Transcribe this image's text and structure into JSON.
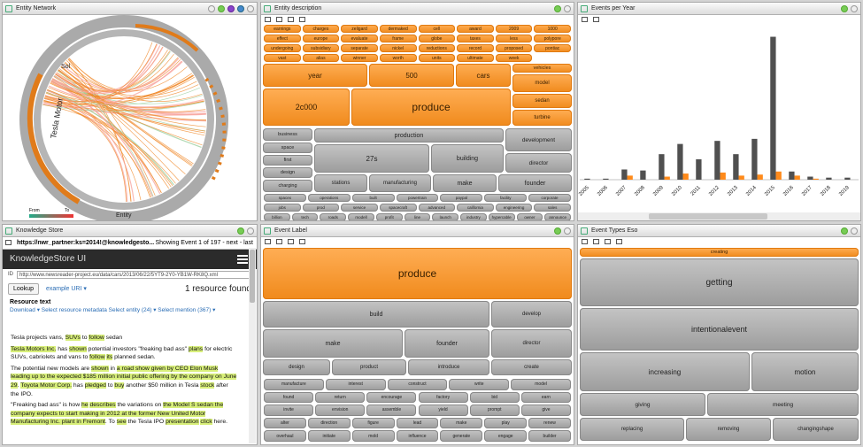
{
  "panels": {
    "network": "Entity Network",
    "entity": "Entity description",
    "events": "Events per Year",
    "ks": "Knowledge Store",
    "label": "Event Label",
    "types": "Event Types Eso"
  },
  "network": {
    "legend_from": "From",
    "legend_to": "To",
    "labels": [
      "Tesla Motor",
      "Entity",
      "Sol"
    ]
  },
  "entity_small": [
    [
      "earnings",
      "charges",
      "zeligard",
      "dermaked",
      "cell",
      "award",
      "2009",
      "1000"
    ],
    [
      "effect",
      "europe",
      "evaluate",
      "frame",
      "globe",
      "taxes",
      "less",
      "polypore"
    ],
    [
      "undergoing",
      "subsidiary",
      "separate",
      "nickel",
      "reductions",
      "record",
      "proposed",
      "pontiac"
    ],
    [
      "vast",
      "alias",
      "winner",
      "worth",
      "units",
      "ultimate",
      "week",
      ""
    ]
  ],
  "entity_big": {
    "year": "year",
    "v500": "500",
    "cars": "cars",
    "vehicles": "vehicles",
    "model": "model",
    "sedan": "sedan",
    "turbine": "turbine",
    "c2000": "2c000",
    "produce": "produce"
  },
  "entity_gray": {
    "business": "business",
    "space": "space",
    "first": "first",
    "design": "design",
    "charging": "charging",
    "production": "production",
    "development": "development",
    "t27s": "27s",
    "building": "building",
    "director": "director",
    "stations": "stations",
    "manufacturing": "manufacturing",
    "make": "make",
    "founder": "founder"
  },
  "entity_gray_small": [
    [
      "spacex",
      "operations",
      "built",
      "powertrain",
      "paypal",
      "facility",
      "corporate"
    ],
    [
      "jobs",
      "prod",
      "service",
      "spacecraft",
      "advanced",
      "california",
      "engineering",
      "sales"
    ],
    [
      "billion",
      "tech",
      "roads",
      "modell",
      "profit",
      "line",
      "launch",
      "industry",
      "hypercable",
      "owner",
      "announce"
    ]
  ],
  "chart_data": {
    "type": "bar",
    "categories": [
      "2005",
      "2006",
      "2007",
      "2008",
      "2009",
      "2010",
      "2011",
      "2012",
      "2013",
      "2014",
      "2015",
      "2016",
      "2017",
      "2018",
      "2019"
    ],
    "series": [
      {
        "values": [
          1,
          1,
          10,
          9,
          25,
          35,
          20,
          38,
          25,
          40,
          140,
          8,
          3,
          2,
          2
        ]
      },
      {
        "values": [
          0,
          0,
          4,
          0,
          3,
          6,
          0,
          7,
          4,
          5,
          8,
          4,
          1,
          0,
          0
        ]
      }
    ],
    "ylim": [
      0,
      150
    ],
    "colors": [
      "#505050",
      "#ff8a1a"
    ]
  },
  "ks": {
    "user": "https://nwr_partner:ks=2014!@knowledgesto...",
    "showing": "Showing Event 1 of 197 - next - last",
    "ui_title": "KnowledgeStore UI",
    "id_label": "ID",
    "id_value": "http://www.newsreader-project.eu/data/cars/2013/06/22/5YT9-2Y0-YB1W-RK8Q.xml",
    "lookup": "Lookup",
    "example": "example URI ▾",
    "found": "1 resource found",
    "resource_text": "Resource text",
    "links": "Download ▾   Select resource metadata   Select entity (24) ▾   Select mention (367) ▾"
  },
  "label_big": "produce",
  "label_gray": {
    "build": "build",
    "develop": "develop",
    "make": "make",
    "founder": "founder",
    "director": "director",
    "design": "design",
    "product": "product",
    "introduce": "introduce",
    "create": "create"
  },
  "label_small": [
    [
      "manufacture",
      "interest",
      "construct",
      "write",
      "model"
    ],
    [
      "found",
      "return",
      "encourage",
      "factory",
      "bid",
      "earn"
    ],
    [
      "invite",
      "envision",
      "assemble",
      "yield",
      "prompt",
      "give"
    ],
    [
      "alter",
      "direction",
      "figure",
      "lead",
      "make",
      "play",
      "renew"
    ],
    [
      "overhaul",
      "initiate",
      "mold",
      "influence",
      "generate",
      "engage",
      "builder"
    ]
  ],
  "types": {
    "creating": "creating",
    "getting": "getting",
    "intentionalevent": "intentionalevent",
    "increasing": "increasing",
    "motion": "motion",
    "giving": "giving",
    "meeting": "meeting",
    "replacing": "replacing",
    "removing": "removing",
    "changingshape": "changingshape"
  }
}
